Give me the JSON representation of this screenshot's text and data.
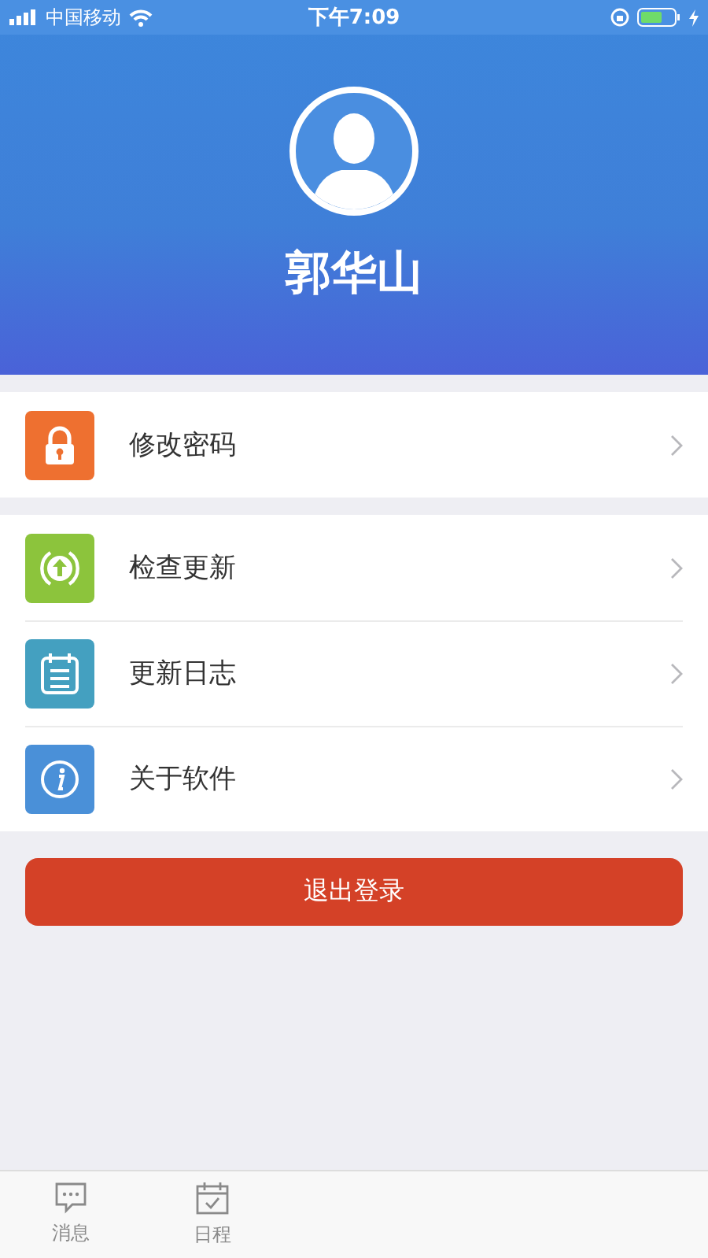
{
  "status_bar": {
    "carrier": "中国移动",
    "time": "下午7:09"
  },
  "profile": {
    "name": "郭华山"
  },
  "menu_groups": [
    {
      "items": [
        {
          "kind": "lock",
          "label": "修改密码"
        }
      ]
    },
    {
      "items": [
        {
          "kind": "update",
          "label": "检查更新"
        },
        {
          "kind": "log",
          "label": "更新日志"
        },
        {
          "kind": "info",
          "label": "关于软件"
        }
      ]
    }
  ],
  "logout_button": "退出登录",
  "tab_bar": [
    {
      "kind": "message",
      "label": "消息",
      "selected": false
    },
    {
      "kind": "calendar",
      "label": "日程",
      "selected": false
    }
  ]
}
